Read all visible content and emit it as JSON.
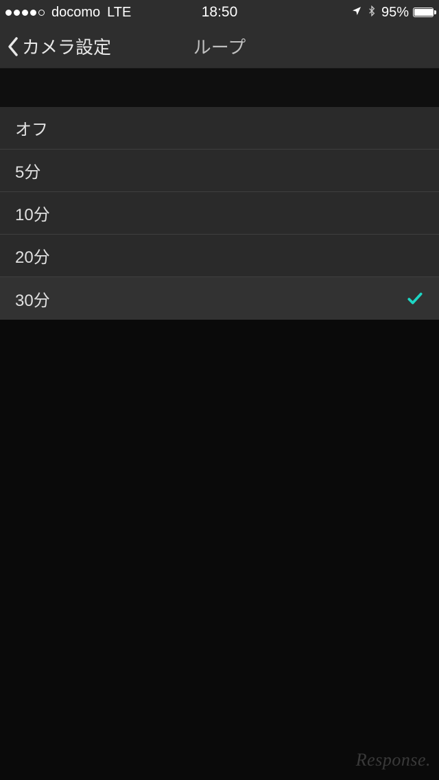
{
  "status_bar": {
    "carrier": "docomo",
    "network": "LTE",
    "time": "18:50",
    "battery": "95%"
  },
  "nav": {
    "back_label": "カメラ設定",
    "title": "ループ"
  },
  "options": [
    {
      "label": "オフ",
      "selected": false
    },
    {
      "label": "5分",
      "selected": false
    },
    {
      "label": "10分",
      "selected": false
    },
    {
      "label": "20分",
      "selected": false
    },
    {
      "label": "30分",
      "selected": true
    }
  ],
  "watermark": "Response."
}
